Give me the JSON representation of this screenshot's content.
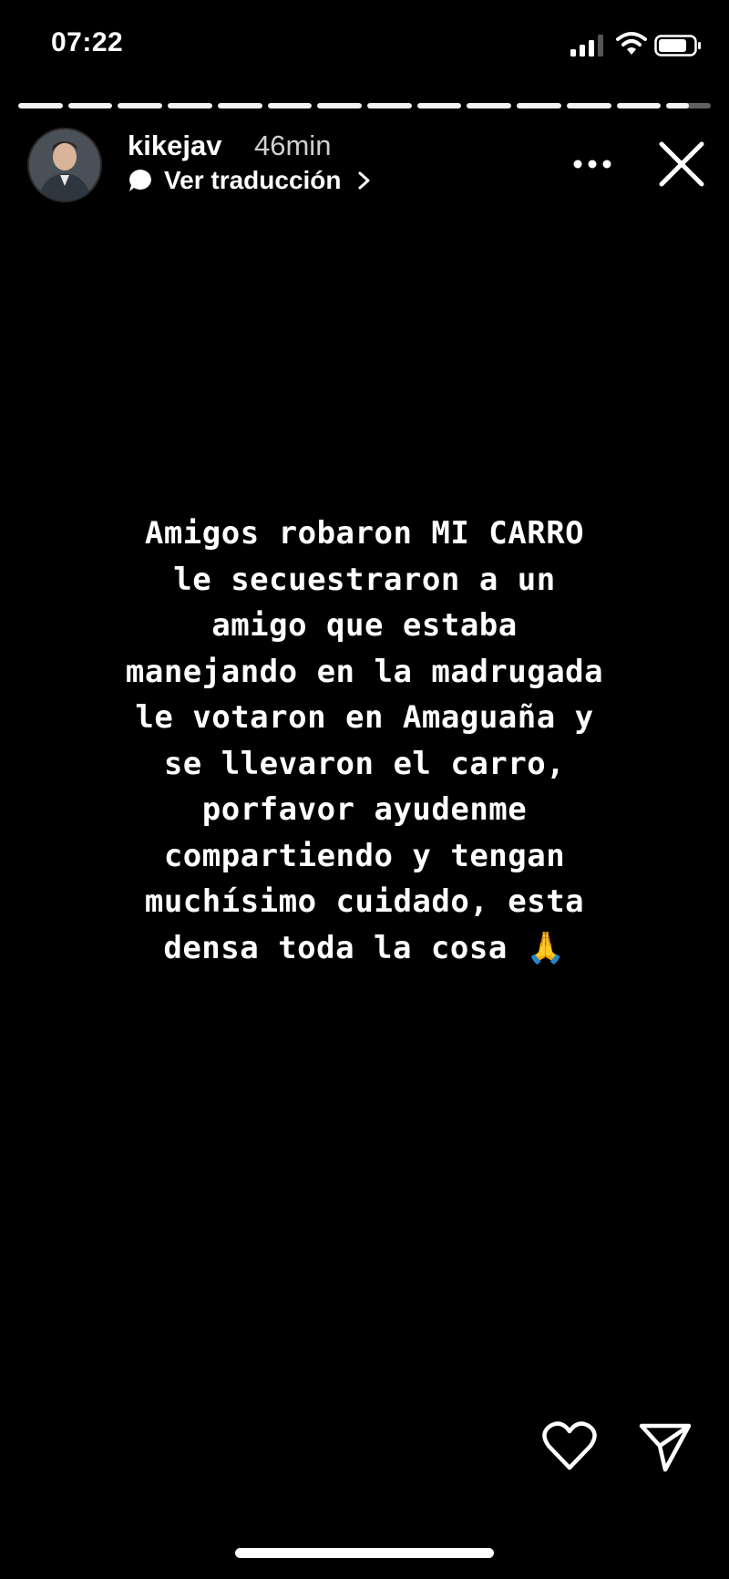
{
  "status_bar": {
    "time": "07:22",
    "icons": [
      "signal-icon",
      "wifi-icon",
      "battery-icon"
    ]
  },
  "story": {
    "segment_count": 14,
    "progress": [
      1,
      1,
      1,
      1,
      1,
      1,
      1,
      1,
      1,
      1,
      1,
      1,
      1,
      0.5
    ],
    "username": "kikejav",
    "time_ago": "46min",
    "translate_label": "Ver traducción",
    "text": "Amigos robaron MI CARRO\nle secuestraron a un\namigo que estaba\nmanejando en la madrugada\nle votaron en Amaguaña y\nse llevaron el carro,\nporfavor ayudenme\ncompartiendo y tengan\nmuchísimo cuidado, esta\ndensa toda la cosa 🙏"
  },
  "icons": {
    "more": "more-options-icon",
    "close": "close-icon",
    "like": "heart-icon",
    "share": "send-icon"
  },
  "colors": {
    "background": "#000000",
    "text": "#ffffff",
    "progress_bg": "rgba(255,255,255,0.38)"
  }
}
